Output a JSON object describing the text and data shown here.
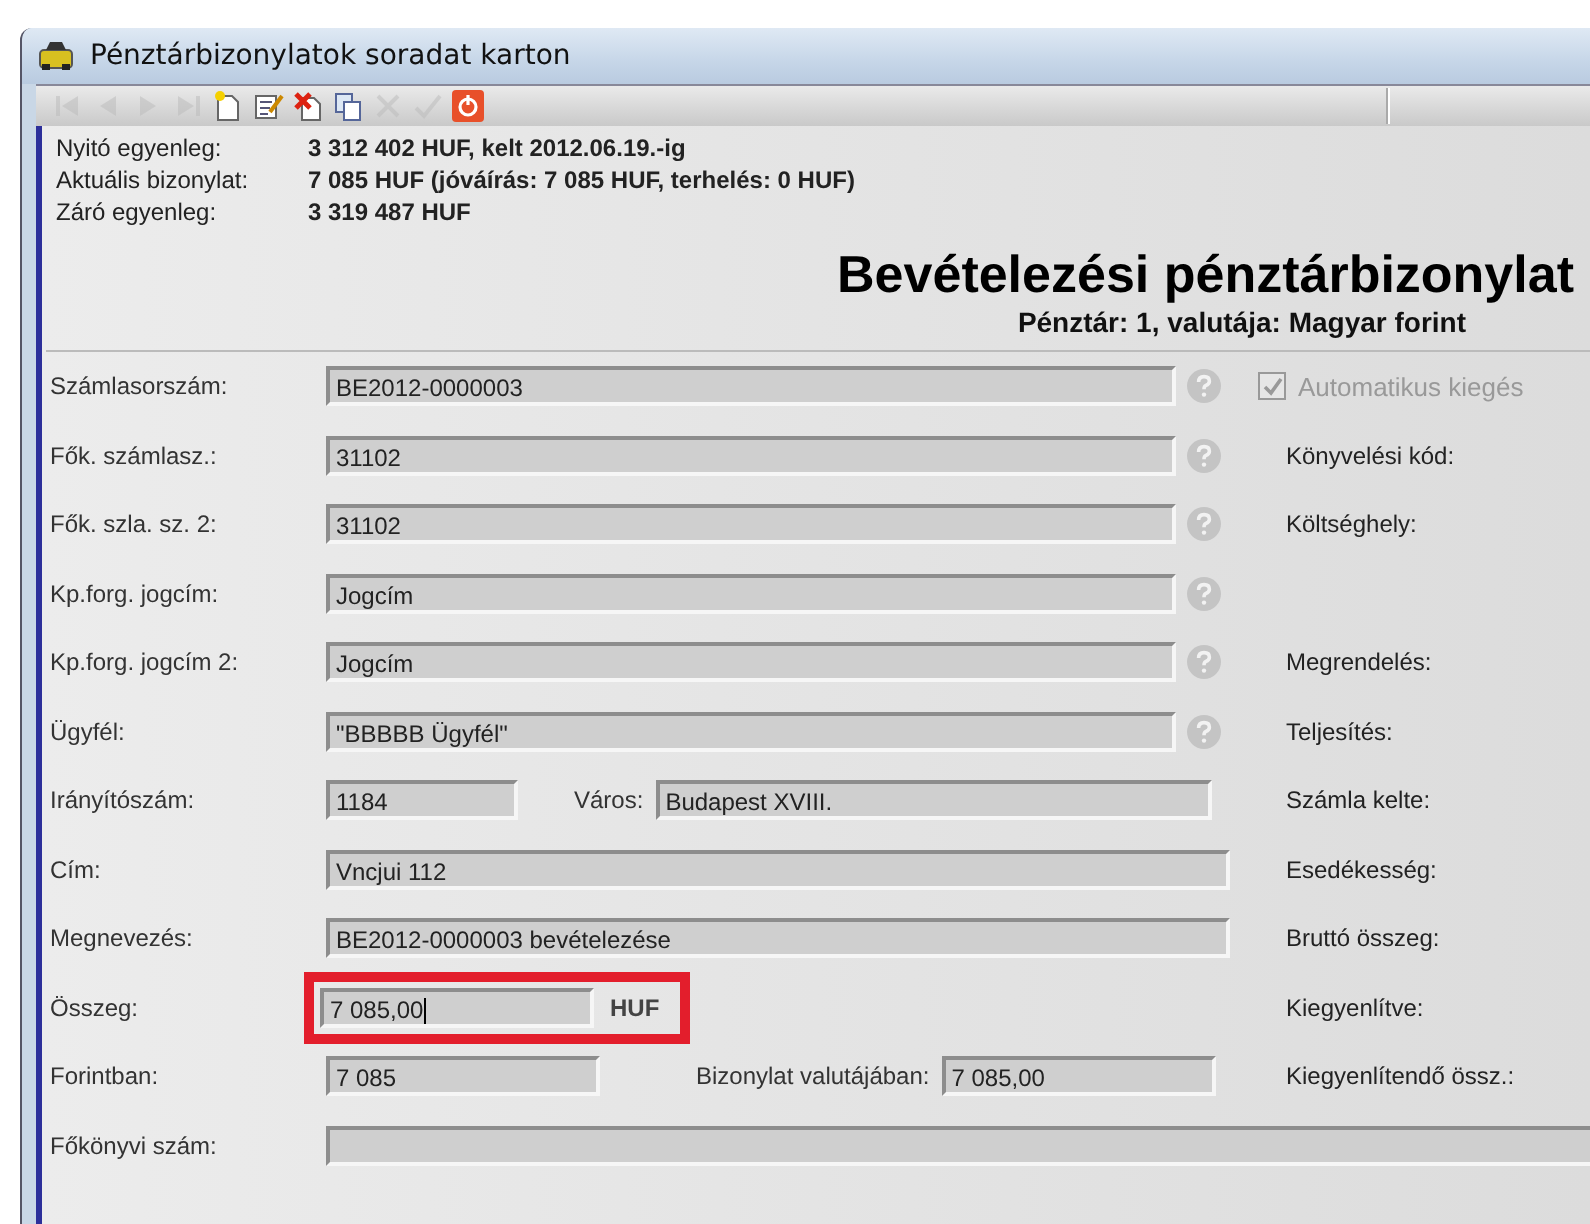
{
  "window": {
    "title": "Pénztárbizonylatok soradat karton"
  },
  "toolbar": [
    {
      "kind": "first",
      "disabled": true
    },
    {
      "kind": "prev",
      "disabled": true
    },
    {
      "kind": "next",
      "disabled": true
    },
    {
      "kind": "last",
      "disabled": true
    },
    {
      "kind": "new",
      "disabled": false
    },
    {
      "kind": "edit",
      "disabled": false
    },
    {
      "kind": "delete",
      "disabled": false
    },
    {
      "kind": "copy",
      "disabled": false
    },
    {
      "kind": "cancel",
      "disabled": true
    },
    {
      "kind": "ok",
      "disabled": true
    },
    {
      "kind": "exit",
      "disabled": false
    }
  ],
  "summary": [
    {
      "label": "Nyitó egyenleg:",
      "value": "3 312 402 HUF, kelt  2012.06.19.-ig"
    },
    {
      "label": "Aktuális bizonylat:",
      "value": "7 085 HUF (jóváírás: 7 085 HUF, terhelés: 0 HUF)"
    },
    {
      "label": "Záró egyenleg:",
      "value": "3 319 487 HUF"
    }
  ],
  "heading": "Bevételezési pénztárbizonylat",
  "subheading": "Pénztár: 1, valutája: Magyar forint",
  "rows": [
    {
      "label": "Számlasorszám:",
      "field": {
        "value": "BE2012-0000003",
        "kind": "wide"
      },
      "help": true,
      "side": {
        "kind": "checkbox",
        "label": "Automatikus kiegés",
        "checked": true,
        "disabled": true
      }
    },
    {
      "label": "Fők. számlasz.:",
      "field": {
        "value": "31102",
        "kind": "wide"
      },
      "help": true,
      "side": {
        "kind": "label",
        "label": "Könyvelési kód:"
      }
    },
    {
      "label": "Fők. szla. sz. 2:",
      "field": {
        "value": "31102",
        "kind": "wide"
      },
      "help": true,
      "side": {
        "kind": "label",
        "label": "Költséghely:"
      }
    },
    {
      "label": "Kp.forg. jogcím:",
      "field": {
        "value": "Jogcím",
        "kind": "wide"
      },
      "help": true
    },
    {
      "label": "Kp.forg. jogcím 2:",
      "field": {
        "value": "Jogcím",
        "kind": "wide"
      },
      "help": true,
      "side": {
        "kind": "label",
        "label": "Megrendelés:"
      }
    },
    {
      "label": "Ügyfél:",
      "field": {
        "value": "\"BBBBB Ügyfél\"",
        "kind": "wide"
      },
      "help": true,
      "side": {
        "kind": "label",
        "label": "Teljesítés:"
      }
    },
    {
      "label": "Irányítószám:",
      "field": {
        "value": "1184",
        "kind": "tiny"
      },
      "help": false,
      "extra": {
        "kind": "city",
        "label": "Város:",
        "value": "Budapest XVIII."
      },
      "side": {
        "kind": "label",
        "label": "Számla kelte:"
      }
    },
    {
      "label": "Cím:",
      "field": {
        "value": "Vncjui 112",
        "kind": "long"
      },
      "help": false,
      "side": {
        "kind": "label",
        "label": "Esedékesség:"
      }
    },
    {
      "label": "Megnevezés:",
      "field": {
        "value": "BE2012-0000003 bevételezése",
        "kind": "long"
      },
      "help": false,
      "side": {
        "kind": "label",
        "label": "Bruttó összeg:"
      }
    },
    {
      "label": "Összeg:",
      "field": {
        "value": "7 085,00",
        "kind": "short",
        "highlighted": true,
        "focused": true
      },
      "help": false,
      "extra": {
        "kind": "unit",
        "label": "HUF"
      },
      "side": {
        "kind": "label",
        "label": "Kiegyenlítve:"
      }
    },
    {
      "label": "Forintban:",
      "field": {
        "value": "7 085",
        "kind": "short"
      },
      "help": false,
      "extra": {
        "kind": "short",
        "label": "Bizonylat valutájában:",
        "value": "7 085,00"
      },
      "side": {
        "kind": "label",
        "label": "Kiegyenlítendő össz.:"
      }
    },
    {
      "label": "Főkönyvi szám:",
      "field": {
        "kind": "full"
      },
      "help": false
    }
  ]
}
